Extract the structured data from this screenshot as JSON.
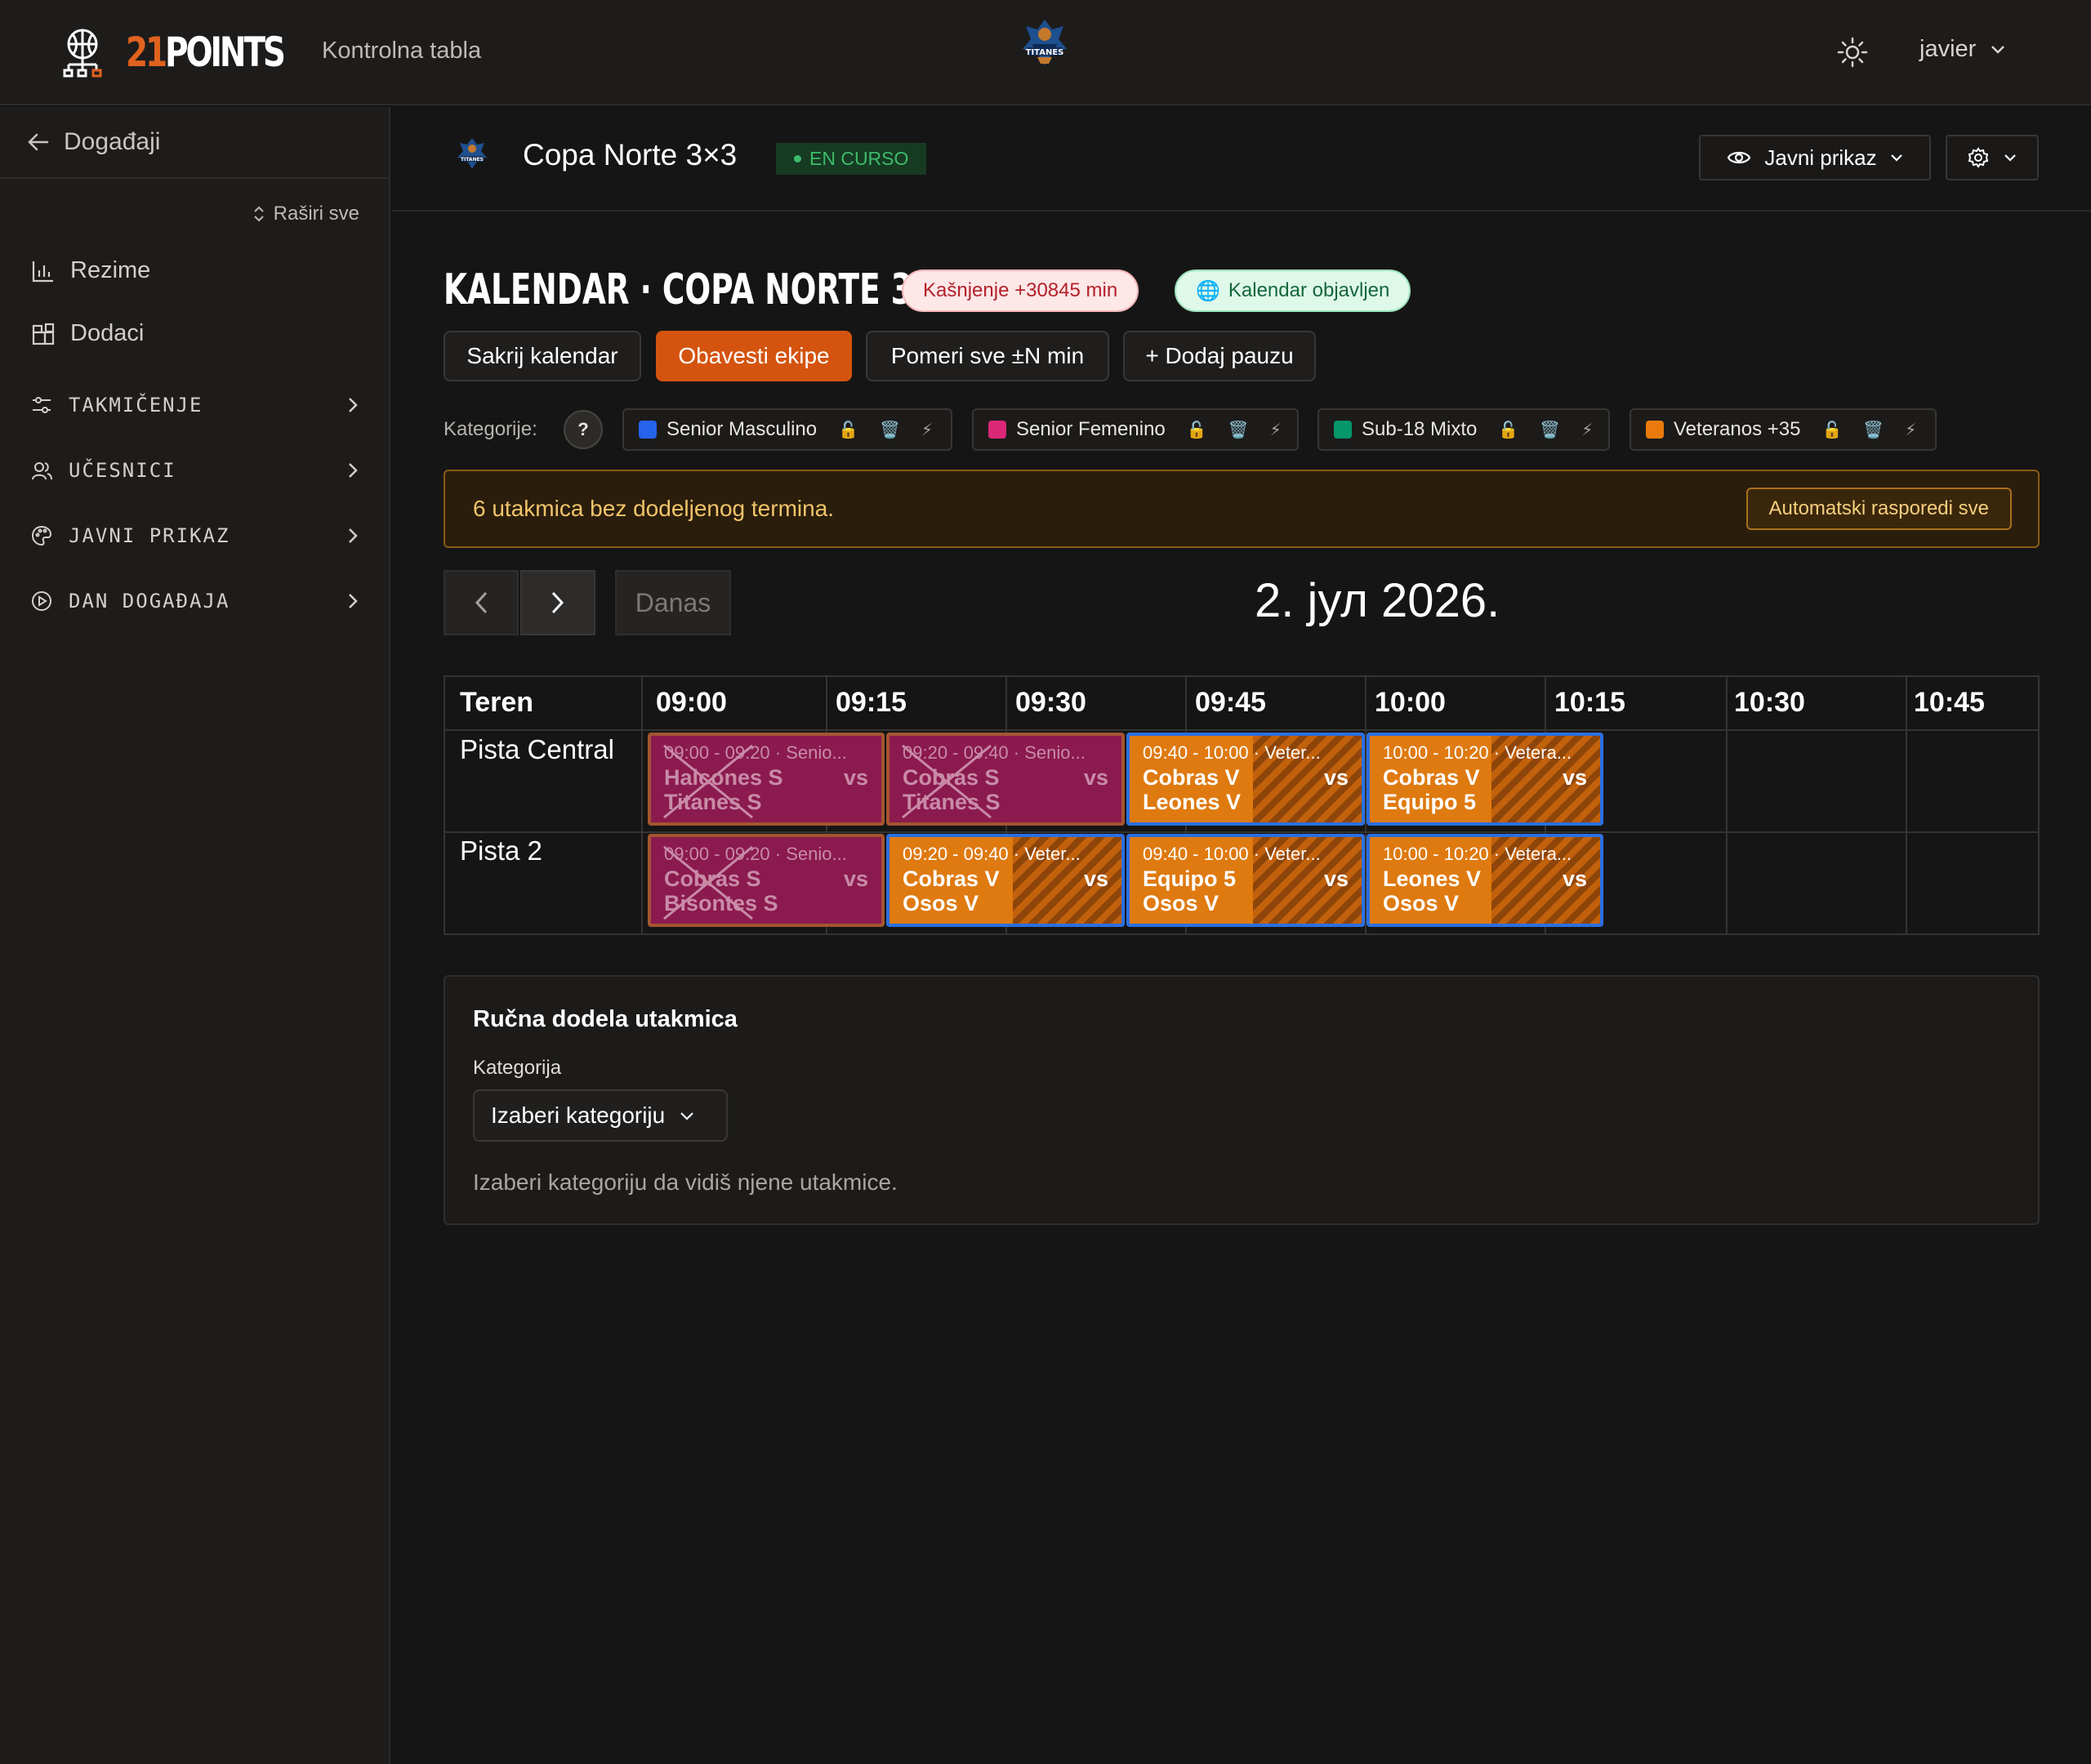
{
  "brand": {
    "logo_prefix": "21",
    "logo_suffix": "POINTS",
    "dashboard_link": "Kontrolna tabla"
  },
  "user": {
    "name": "javier"
  },
  "sidebar": {
    "back_label": "Događaji",
    "expand_all": "Raširi sve",
    "items": [
      {
        "label": "Rezime",
        "icon": "bar-chart-icon"
      },
      {
        "label": "Dodaci",
        "icon": "puzzle-icon"
      }
    ],
    "sections": [
      {
        "label": "TAKMIČENJE",
        "icon": "sliders-icon"
      },
      {
        "label": "UČESNICI",
        "icon": "users-icon"
      },
      {
        "label": "JAVNI PRIKAZ",
        "icon": "palette-icon"
      },
      {
        "label": "DAN DOGAĐAJA",
        "icon": "play-circle-icon"
      }
    ]
  },
  "event": {
    "title": "Copa Norte 3×3",
    "status": "EN CURSO",
    "public_view_label": "Javni prikaz"
  },
  "calendar": {
    "title": "KALENDAR · COPA NORTE 3X3",
    "delay_pill": "Kašnjenje +30845 min",
    "published_pill": "Kalendar objavljen",
    "actions": {
      "hide": "Sakrij kalendar",
      "notify": "Obavesti ekipe",
      "shift": "Pomeri sve ±N min",
      "add_break": "+ Dodaj pauzu"
    },
    "categories_label": "Kategorije:",
    "help": "?",
    "categories": [
      {
        "name": "Senior Masculino",
        "color": "#2563eb"
      },
      {
        "name": "Senior Femenino",
        "color": "#db2777"
      },
      {
        "name": "Sub-18 Mixto",
        "color": "#059669"
      },
      {
        "name": "Veteranos +35",
        "color": "#ea7a0c"
      }
    ],
    "tool_icons": {
      "lock": "🔓",
      "trash": "🗑️",
      "bolt": "⚡"
    },
    "warning_text": "6 utakmica bez dodeljenog termina.",
    "warning_button": "Automatski rasporedi sve",
    "today_label": "Danas",
    "date_title": "2. јул 2026.",
    "grid_header": "Teren",
    "times": [
      "09:00",
      "09:15",
      "09:30",
      "09:45",
      "10:00",
      "10:15",
      "10:30",
      "10:45"
    ],
    "courts": [
      "Pista Central",
      "Pista 2"
    ],
    "matches": [
      {
        "time": "09:00 - 09:20 · Senio...",
        "home": "Halcones S",
        "away": "Titanes S",
        "vs": "vs",
        "state": "cancelled"
      },
      {
        "time": "09:20 - 09:40 · Senio...",
        "home": "Cobras S",
        "away": "Titanes S",
        "vs": "vs",
        "state": "cancelled"
      },
      {
        "time": "09:40 - 10:00 · Veter...",
        "home": "Cobras V",
        "away": "Leones V",
        "vs": "vs",
        "state": "active"
      },
      {
        "time": "10:00 - 10:20 · Vetera...",
        "home": "Cobras V",
        "away": "Equipo 5",
        "vs": "vs",
        "state": "active"
      },
      {
        "time": "09:00 - 09:20 · Senio...",
        "home": "Cobras S",
        "away": "Bisontes S",
        "vs": "vs",
        "state": "cancelled"
      },
      {
        "time": "09:20 - 09:40 · Veter...",
        "home": "Cobras V",
        "away": "Osos V",
        "vs": "vs",
        "state": "active"
      },
      {
        "time": "09:40 - 10:00 · Veter...",
        "home": "Equipo 5",
        "away": "Osos V",
        "vs": "vs",
        "state": "active"
      },
      {
        "time": "10:00 - 10:20 · Vetera...",
        "home": "Leones V",
        "away": "Osos V",
        "vs": "vs",
        "state": "active"
      }
    ]
  },
  "manual": {
    "title": "Ručna dodela utakmica",
    "category_label": "Kategorija",
    "select_placeholder": "Izaberi kategoriju",
    "hint": "Izaberi kategoriju da vidiš njene utakmice."
  }
}
